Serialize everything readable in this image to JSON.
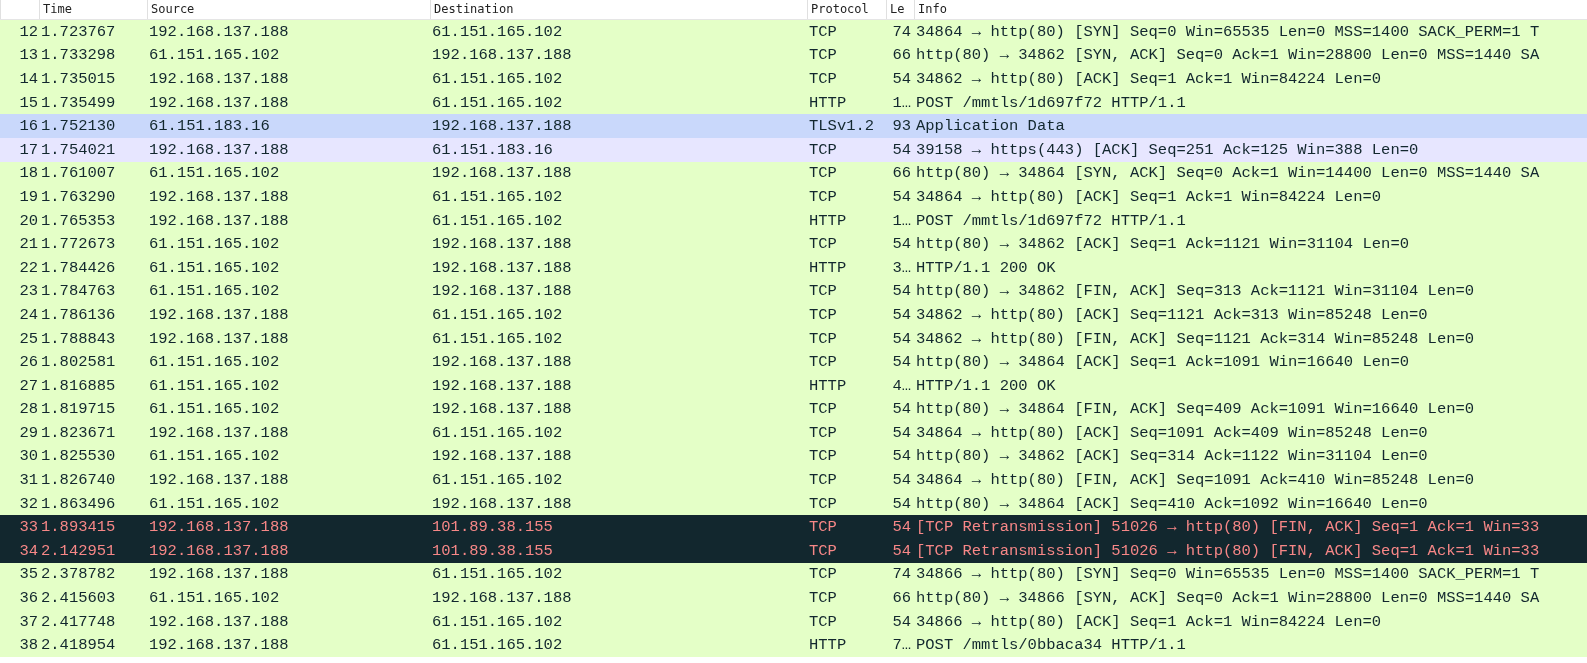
{
  "table": {
    "columns": [
      "Time",
      "Source",
      "Destination",
      "Protocol",
      "Le",
      "Info"
    ],
    "rows": [
      {
        "no": "12",
        "time": "1.723767",
        "source": "192.168.137.188",
        "destination": "61.151.165.102",
        "protocol": "TCP",
        "length": "74",
        "info": "34864 → http(80) [SYN] Seq=0 Win=65535 Len=0 MSS=1400 SACK_PERM=1 T",
        "kind": "normal"
      },
      {
        "no": "13",
        "time": "1.733298",
        "source": "61.151.165.102",
        "destination": "192.168.137.188",
        "protocol": "TCP",
        "length": "66",
        "info": "http(80) → 34862 [SYN, ACK] Seq=0 Ack=1 Win=28800 Len=0 MSS=1440 SA",
        "kind": "normal"
      },
      {
        "no": "14",
        "time": "1.735015",
        "source": "192.168.137.188",
        "destination": "61.151.165.102",
        "protocol": "TCP",
        "length": "54",
        "info": "34862 → http(80) [ACK] Seq=1 Ack=1 Win=84224 Len=0",
        "kind": "normal"
      },
      {
        "no": "15",
        "time": "1.735499",
        "source": "192.168.137.188",
        "destination": "61.151.165.102",
        "protocol": "HTTP",
        "length": "1…",
        "info": "POST /mmtls/1d697f72 HTTP/1.1",
        "kind": "normal"
      },
      {
        "no": "16",
        "time": "1.752130",
        "source": "61.151.183.16",
        "destination": "192.168.137.188",
        "protocol": "TLSv1.2",
        "length": "93",
        "info": "Application Data",
        "kind": "tls"
      },
      {
        "no": "17",
        "time": "1.754021",
        "source": "192.168.137.188",
        "destination": "61.151.183.16",
        "protocol": "TCP",
        "length": "54",
        "info": "39158 → https(443) [ACK] Seq=251 Ack=125 Win=388 Len=0",
        "kind": "https"
      },
      {
        "no": "18",
        "time": "1.761007",
        "source": "61.151.165.102",
        "destination": "192.168.137.188",
        "protocol": "TCP",
        "length": "66",
        "info": "http(80) → 34864 [SYN, ACK] Seq=0 Ack=1 Win=14400 Len=0 MSS=1440 SA",
        "kind": "normal"
      },
      {
        "no": "19",
        "time": "1.763290",
        "source": "192.168.137.188",
        "destination": "61.151.165.102",
        "protocol": "TCP",
        "length": "54",
        "info": "34864 → http(80) [ACK] Seq=1 Ack=1 Win=84224 Len=0",
        "kind": "normal"
      },
      {
        "no": "20",
        "time": "1.765353",
        "source": "192.168.137.188",
        "destination": "61.151.165.102",
        "protocol": "HTTP",
        "length": "1…",
        "info": "POST /mmtls/1d697f72 HTTP/1.1",
        "kind": "normal"
      },
      {
        "no": "21",
        "time": "1.772673",
        "source": "61.151.165.102",
        "destination": "192.168.137.188",
        "protocol": "TCP",
        "length": "54",
        "info": "http(80) → 34862 [ACK] Seq=1 Ack=1121 Win=31104 Len=0",
        "kind": "normal"
      },
      {
        "no": "22",
        "time": "1.784426",
        "source": "61.151.165.102",
        "destination": "192.168.137.188",
        "protocol": "HTTP",
        "length": "3…",
        "info": "HTTP/1.1 200 OK",
        "kind": "normal"
      },
      {
        "no": "23",
        "time": "1.784763",
        "source": "61.151.165.102",
        "destination": "192.168.137.188",
        "protocol": "TCP",
        "length": "54",
        "info": "http(80) → 34862 [FIN, ACK] Seq=313 Ack=1121 Win=31104 Len=0",
        "kind": "normal"
      },
      {
        "no": "24",
        "time": "1.786136",
        "source": "192.168.137.188",
        "destination": "61.151.165.102",
        "protocol": "TCP",
        "length": "54",
        "info": "34862 → http(80) [ACK] Seq=1121 Ack=313 Win=85248 Len=0",
        "kind": "normal"
      },
      {
        "no": "25",
        "time": "1.788843",
        "source": "192.168.137.188",
        "destination": "61.151.165.102",
        "protocol": "TCP",
        "length": "54",
        "info": "34862 → http(80) [FIN, ACK] Seq=1121 Ack=314 Win=85248 Len=0",
        "kind": "normal"
      },
      {
        "no": "26",
        "time": "1.802581",
        "source": "61.151.165.102",
        "destination": "192.168.137.188",
        "protocol": "TCP",
        "length": "54",
        "info": "http(80) → 34864 [ACK] Seq=1 Ack=1091 Win=16640 Len=0",
        "kind": "normal"
      },
      {
        "no": "27",
        "time": "1.816885",
        "source": "61.151.165.102",
        "destination": "192.168.137.188",
        "protocol": "HTTP",
        "length": "4…",
        "info": "HTTP/1.1 200 OK",
        "kind": "normal"
      },
      {
        "no": "28",
        "time": "1.819715",
        "source": "61.151.165.102",
        "destination": "192.168.137.188",
        "protocol": "TCP",
        "length": "54",
        "info": "http(80) → 34864 [FIN, ACK] Seq=409 Ack=1091 Win=16640 Len=0",
        "kind": "normal"
      },
      {
        "no": "29",
        "time": "1.823671",
        "source": "192.168.137.188",
        "destination": "61.151.165.102",
        "protocol": "TCP",
        "length": "54",
        "info": "34864 → http(80) [ACK] Seq=1091 Ack=409 Win=85248 Len=0",
        "kind": "normal"
      },
      {
        "no": "30",
        "time": "1.825530",
        "source": "61.151.165.102",
        "destination": "192.168.137.188",
        "protocol": "TCP",
        "length": "54",
        "info": "http(80) → 34862 [ACK] Seq=314 Ack=1122 Win=31104 Len=0",
        "kind": "normal"
      },
      {
        "no": "31",
        "time": "1.826740",
        "source": "192.168.137.188",
        "destination": "61.151.165.102",
        "protocol": "TCP",
        "length": "54",
        "info": "34864 → http(80) [FIN, ACK] Seq=1091 Ack=410 Win=85248 Len=0",
        "kind": "normal"
      },
      {
        "no": "32",
        "time": "1.863496",
        "source": "61.151.165.102",
        "destination": "192.168.137.188",
        "protocol": "TCP",
        "length": "54",
        "info": "http(80) → 34864 [ACK] Seq=410 Ack=1092 Win=16640 Len=0",
        "kind": "normal"
      },
      {
        "no": "33",
        "time": "1.893415",
        "source": "192.168.137.188",
        "destination": "101.89.38.155",
        "protocol": "TCP",
        "length": "54",
        "info": "[TCP Retransmission] 51026 → http(80) [FIN, ACK] Seq=1 Ack=1 Win=33",
        "kind": "bad"
      },
      {
        "no": "34",
        "time": "2.142951",
        "source": "192.168.137.188",
        "destination": "101.89.38.155",
        "protocol": "TCP",
        "length": "54",
        "info": "[TCP Retransmission] 51026 → http(80) [FIN, ACK] Seq=1 Ack=1 Win=33",
        "kind": "bad"
      },
      {
        "no": "35",
        "time": "2.378782",
        "source": "192.168.137.188",
        "destination": "61.151.165.102",
        "protocol": "TCP",
        "length": "74",
        "info": "34866 → http(80) [SYN] Seq=0 Win=65535 Len=0 MSS=1400 SACK_PERM=1 T",
        "kind": "normal"
      },
      {
        "no": "36",
        "time": "2.415603",
        "source": "61.151.165.102",
        "destination": "192.168.137.188",
        "protocol": "TCP",
        "length": "66",
        "info": "http(80) → 34866 [SYN, ACK] Seq=0 Ack=1 Win=28800 Len=0 MSS=1440 SA",
        "kind": "normal"
      },
      {
        "no": "37",
        "time": "2.417748",
        "source": "192.168.137.188",
        "destination": "61.151.165.102",
        "protocol": "TCP",
        "length": "54",
        "info": "34866 → http(80) [ACK] Seq=1 Ack=1 Win=84224 Len=0",
        "kind": "normal"
      },
      {
        "no": "38",
        "time": "2.418954",
        "source": "192.168.137.188",
        "destination": "61.151.165.102",
        "protocol": "HTTP",
        "length": "7…",
        "info": "POST /mmtls/0bbaca34 HTTP/1.1",
        "kind": "normal"
      }
    ]
  }
}
